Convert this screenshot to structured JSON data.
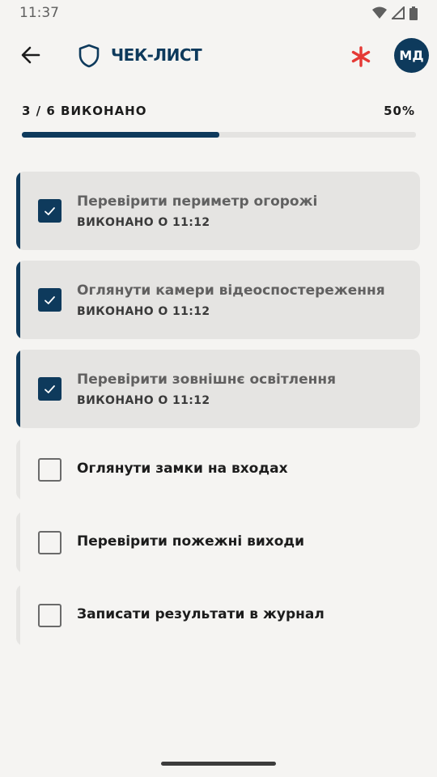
{
  "status_bar": {
    "time": "11:37",
    "icons": [
      "wifi-icon",
      "signal-icon",
      "battery-icon"
    ]
  },
  "app_bar": {
    "title": "ЧЕК-ЛИСТ",
    "avatar_initials": "МД",
    "icons": {
      "back": "arrow-left-icon",
      "logo": "shield-icon",
      "action": "asterisk-icon"
    }
  },
  "progress": {
    "label": "3 / 6 ВИКОНАНО",
    "percent_text": "50%",
    "value": 0.5
  },
  "checklist": {
    "items": [
      {
        "title": "Перевірити периметр огорожі",
        "meta": "ВИКОНАНО О 11:12",
        "checked": true
      },
      {
        "title": "Оглянути камери відеоспостереження",
        "meta": "ВИКОНАНО О 11:12",
        "checked": true
      },
      {
        "title": "Перевірити зовнішнє освітлення",
        "meta": "ВИКОНАНО О 11:12",
        "checked": true
      },
      {
        "title": "Оглянути замки на входах",
        "meta": "",
        "checked": false
      },
      {
        "title": "Перевірити пожежні виходи",
        "meta": "",
        "checked": false
      },
      {
        "title": "Записати результати в журнал",
        "meta": "",
        "checked": false
      }
    ]
  },
  "colors": {
    "primary": "#0E3A5C",
    "accent": "#E53935",
    "background": "#F5F4F2",
    "done_card": "#E5E4E2"
  }
}
